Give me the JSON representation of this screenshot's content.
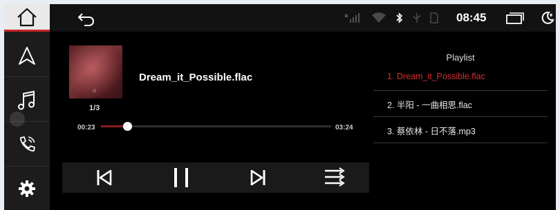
{
  "statusbar": {
    "time": "08:45",
    "icons": [
      "back-arrow-icon",
      "no-signal-icon",
      "wifi-icon",
      "bluetooth-icon",
      "usb-icon",
      "sd-card-icon",
      "recent-apps-icon",
      "night-mode-icon"
    ]
  },
  "sidebar": {
    "items": [
      "home-icon",
      "navigation-icon",
      "music-icon",
      "phone-icon",
      "settings-icon"
    ],
    "accent": "#c8242a"
  },
  "player": {
    "title": "Dream_it_Possible.flac",
    "track_position": "1/3",
    "elapsed": "00:23",
    "duration": "03:24",
    "progress_fraction": 0.113,
    "cover_logo": "⌂",
    "controls": [
      "previous-icon",
      "pause-icon",
      "next-icon",
      "playlist-mode-icon"
    ]
  },
  "playlist": {
    "title": "Playlist",
    "active_color": "#d42e2e",
    "items": [
      {
        "label": "1. Dream_it_Possible.flac",
        "active": true
      },
      {
        "label": "2. 半阳 - 一曲相思.flac",
        "active": false
      },
      {
        "label": "3. 蔡依林 - 日不落.mp3",
        "active": false
      }
    ]
  }
}
